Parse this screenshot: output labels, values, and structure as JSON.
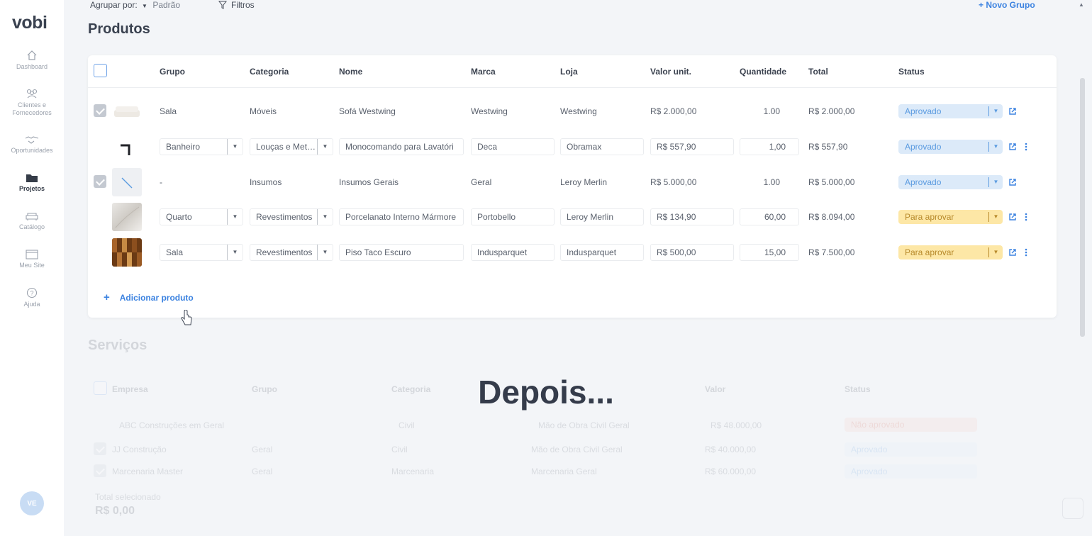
{
  "brand": {
    "logo_text": "vobi",
    "accent": "#3b82e0"
  },
  "sidebar": {
    "items": [
      {
        "label": "Dashboard",
        "icon": "home-icon"
      },
      {
        "label": "Clientes e Fornecedores",
        "icon": "users-icon"
      },
      {
        "label": "Oportunidades",
        "icon": "handshake-icon"
      },
      {
        "label": "Projetos",
        "icon": "folder-icon",
        "active": true
      },
      {
        "label": "Catálogo",
        "icon": "sofa-icon"
      },
      {
        "label": "Meu Site",
        "icon": "browser-icon"
      },
      {
        "label": "Ajuda",
        "icon": "help-icon"
      }
    ],
    "avatar_initials": "VE"
  },
  "toolbar": {
    "group_by_label": "Agrupar por:",
    "group_by_value": "Padrão",
    "filters_label": "Filtros",
    "new_group_label": "+ Novo Grupo"
  },
  "products": {
    "title": "Produtos",
    "columns": {
      "group": "Grupo",
      "category": "Categoria",
      "name": "Nome",
      "brand": "Marca",
      "store": "Loja",
      "unit_value": "Valor unit.",
      "quantity": "Quantidade",
      "total": "Total",
      "status": "Status"
    },
    "rows": [
      {
        "group": "Sala",
        "category": "Móveis",
        "name": "Sofá Westwing",
        "brand": "Westwing",
        "store": "Westwing",
        "unit_value": "R$ 2.000,00",
        "quantity": "1.00",
        "total": "R$ 2.000,00",
        "status": "Aprovado"
      },
      {
        "group": "Banheiro",
        "category": "Louças e Met…",
        "name": "Monocomando para Lavatóri",
        "brand": "Deca",
        "store": "Obramax",
        "unit_value": "R$ 557,90",
        "quantity": "1,00",
        "total": "R$ 557,90",
        "status": "Aprovado"
      },
      {
        "group": "-",
        "category": "Insumos",
        "name": "Insumos Gerais",
        "brand": "Geral",
        "store": "Leroy Merlin",
        "unit_value": "R$ 5.000,00",
        "quantity": "1.00",
        "total": "R$ 5.000,00",
        "status": "Aprovado"
      },
      {
        "group": "Quarto",
        "category": "Revestimentos",
        "name": "Porcelanato Interno Mármore",
        "brand": "Portobello",
        "store": "Leroy Merlin",
        "unit_value": "R$ 134,90",
        "quantity": "60,00",
        "total": "R$ 8.094,00",
        "status": "Para aprovar"
      },
      {
        "group": "Sala",
        "category": "Revestimentos",
        "name": "Piso Taco Escuro",
        "brand": "Indusparquet",
        "store": "Indusparquet",
        "unit_value": "R$ 500,00",
        "quantity": "15,00",
        "total": "R$ 7.500,00",
        "status": "Para aprovar"
      }
    ],
    "add_product_label": "Adicionar produto"
  },
  "services": {
    "title": "Serviços",
    "columns": {
      "company": "Empresa",
      "group": "Grupo",
      "category": "Categoria",
      "value": "Valor",
      "status": "Status"
    },
    "rows": [
      {
        "company": "ABC Construções em Geral",
        "group": "",
        "category": "Civil",
        "name": "Mão de Obra Civil Geral",
        "value": "R$ 48.000,00",
        "status": "Não aprovado"
      },
      {
        "company": "JJ Construção",
        "group": "Geral",
        "category": "Civil",
        "name": "Mão de Obra Civil Geral",
        "value": "R$ 40.000,00",
        "status": "Aprovado"
      },
      {
        "company": "Marcenaria Master",
        "group": "Geral",
        "category": "Marcenaria",
        "name": "Marcenaria Geral",
        "value": "R$ 60.000,00",
        "status": "Aprovado"
      }
    ],
    "total_selected_label": "Total selecionado",
    "total_selected_value": "R$ 0,00"
  },
  "overlay": {
    "text": "Depois..."
  },
  "colors": {
    "approved_bg": "#dceaf9",
    "approved_text": "#5b9be0",
    "pending_bg": "#fde7a6",
    "pending_text": "#b7892a",
    "rejected_bg": "#f8c9c0"
  }
}
